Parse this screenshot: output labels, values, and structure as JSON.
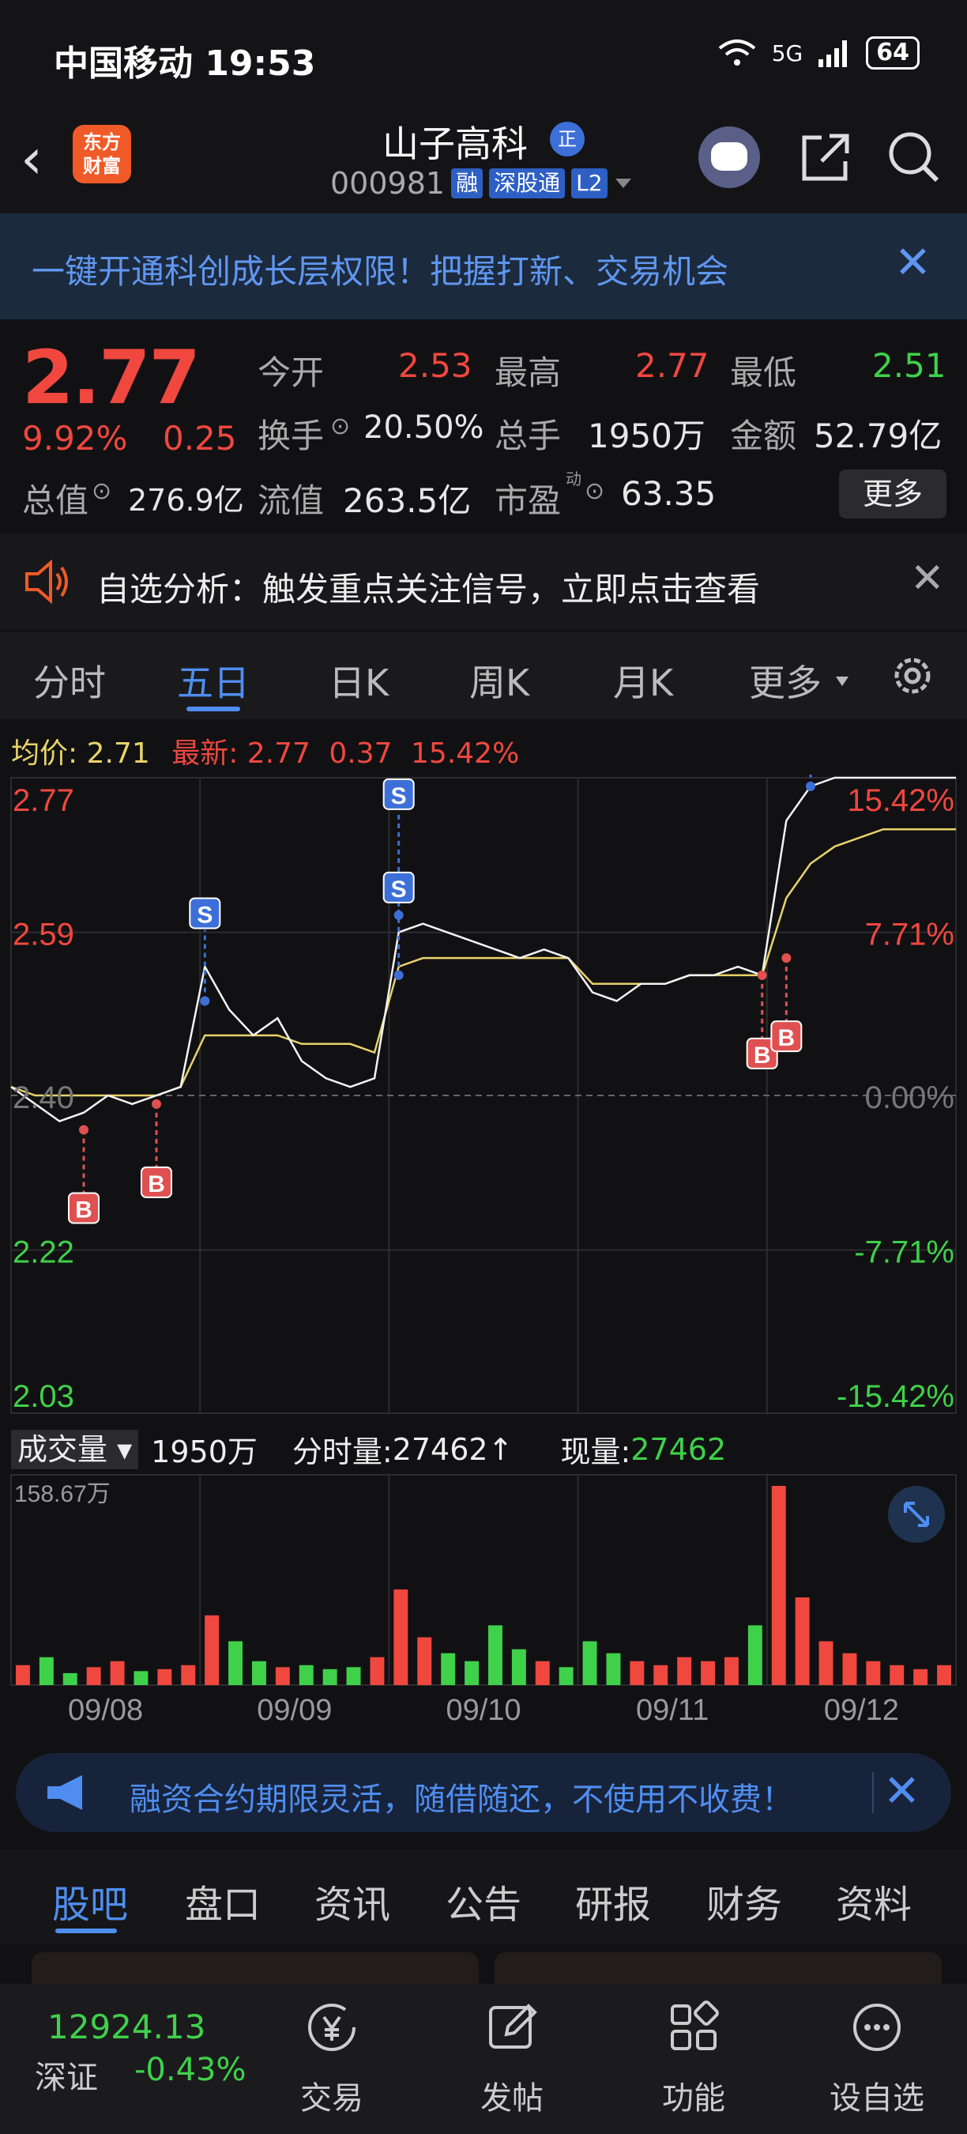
{
  "status_bar": {
    "carrier_time": "中国移动 19:53",
    "network": "5G",
    "battery": "64"
  },
  "header": {
    "logo_line1": "东方",
    "logo_line2": "财富",
    "title": "山子高科",
    "title_badge": "正",
    "code": "000981",
    "tags": [
      "融",
      "深股通",
      "L2"
    ]
  },
  "banner_top": {
    "text": "一键开通科创成长层权限！把握打新、交易机会"
  },
  "quote": {
    "price": "2.77",
    "change_pct": "9.92%",
    "change": "0.25",
    "labels": {
      "open": "今开",
      "high": "最高",
      "low": "最低",
      "turnover": "换手",
      "volume": "总手",
      "amount": "金额",
      "total_mv": "总值",
      "float_mv": "流值",
      "pe": "市盈",
      "pe_sup": "动"
    },
    "values": {
      "open": "2.53",
      "high": "2.77",
      "low": "2.51",
      "turnover": "20.50%",
      "volume": "1950万",
      "amount": "52.79亿",
      "total_mv": "276.9亿",
      "float_mv": "263.5亿",
      "pe": "63.35"
    },
    "more": "更多"
  },
  "notice": {
    "text": "自选分析：触发重点关注信号，立即点击查看"
  },
  "tabs": [
    "分时",
    "五日",
    "日K",
    "周K",
    "月K",
    "更多"
  ],
  "active_tab": "五日",
  "avg_line": {
    "avg_label": "均价:",
    "avg": "2.71",
    "latest_label": "最新:",
    "latest": "2.77",
    "chg": "0.37",
    "pct": "15.42%"
  },
  "chart_data": {
    "type": "line",
    "y_left_ticks": [
      "2.77",
      "2.59",
      "2.40",
      "2.22",
      "2.03"
    ],
    "y_right_ticks": [
      "15.42%",
      "7.71%",
      "0.00%",
      "-7.71%",
      "-15.42%"
    ],
    "x_labels": [
      "09/08",
      "09/09",
      "09/10",
      "09/11",
      "09/12"
    ],
    "ylim": [
      2.03,
      2.77
    ],
    "base": 2.4,
    "series": [
      {
        "values": [
          2.41,
          2.39,
          2.37,
          2.38,
          2.4,
          2.39,
          2.4,
          2.41,
          2.55,
          2.5,
          2.47,
          2.49,
          2.44,
          2.42,
          2.41,
          2.42,
          2.59,
          2.6,
          2.59,
          2.58,
          2.57,
          2.56,
          2.57,
          2.56,
          2.52,
          2.51,
          2.53,
          2.53,
          2.54,
          2.54,
          2.55,
          2.54,
          2.72,
          2.76,
          2.77,
          2.77,
          2.77,
          2.77,
          2.77,
          2.77
        ]
      },
      {
        "values": [
          2.41,
          2.4,
          2.4,
          2.4,
          2.4,
          2.4,
          2.4,
          2.41,
          2.47,
          2.47,
          2.47,
          2.47,
          2.46,
          2.46,
          2.46,
          2.45,
          2.55,
          2.56,
          2.56,
          2.56,
          2.56,
          2.56,
          2.56,
          2.56,
          2.53,
          2.53,
          2.53,
          2.53,
          2.54,
          2.54,
          2.54,
          2.54,
          2.63,
          2.67,
          2.69,
          2.7,
          2.71,
          2.71,
          2.71,
          2.71
        ]
      }
    ],
    "markers": [
      {
        "label": "B",
        "pos": 3,
        "value": 2.36
      },
      {
        "label": "B",
        "pos": 6,
        "value": 2.39
      },
      {
        "label": "S",
        "pos": 8,
        "value": 2.51
      },
      {
        "label": "S",
        "pos": 16,
        "value": 2.61
      },
      {
        "label": "S",
        "pos": 16,
        "value": 2.54
      },
      {
        "label": "B",
        "pos": 31,
        "value": 2.54
      },
      {
        "label": "B",
        "pos": 32,
        "value": 2.56
      },
      {
        "label": "S",
        "pos": 33,
        "value": 2.76
      }
    ],
    "volume": {
      "max_label": "158.67万",
      "values": [
        10,
        14,
        6,
        9,
        12,
        7,
        8,
        10,
        35,
        22,
        12,
        9,
        10,
        8,
        9,
        14,
        48,
        24,
        16,
        12,
        30,
        18,
        12,
        9,
        22,
        16,
        12,
        10,
        14,
        12,
        14,
        30,
        100,
        44,
        22,
        16,
        12,
        10,
        8,
        10
      ]
    }
  },
  "volume_bar": {
    "selector": "成交量",
    "total": "1950万",
    "fen_label": "分时量:",
    "fen_val": "27462",
    "arrow": "↑",
    "now_label": "现量:",
    "now_val": "27462"
  },
  "promo": {
    "text": "融资合约期限灵活，随借随还，不使用不收费！"
  },
  "bottom_tabs": [
    "股吧",
    "盘口",
    "资讯",
    "公告",
    "研报",
    "财务",
    "资料"
  ],
  "index": {
    "value": "12924.13",
    "name": "深证",
    "change": "-0.43%"
  },
  "nav": [
    "交易",
    "发帖",
    "功能",
    "设自选"
  ],
  "colors": {
    "up": "#f0473f",
    "down": "#3fd14a",
    "accent": "#4f8ef0",
    "avg": "#e8d26a"
  }
}
